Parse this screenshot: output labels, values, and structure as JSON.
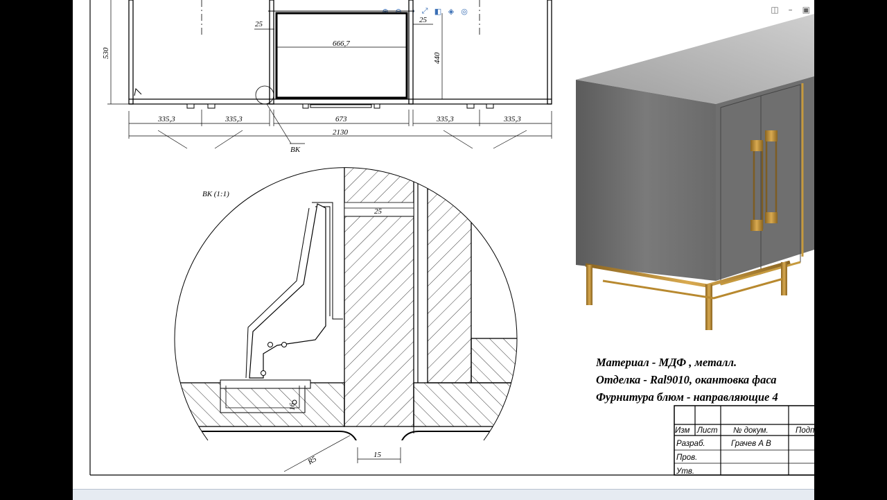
{
  "toolbar": {
    "icons": [
      "zoom-in-icon",
      "zoom-out-icon",
      "rotate-icon",
      "pan-icon",
      "view-icon",
      "display-icon",
      "settings-icon"
    ]
  },
  "window_controls": {
    "icons": [
      "restore-icon",
      "minimize-icon",
      "maximize-icon"
    ]
  },
  "drawing": {
    "top_dims": {
      "d530": "530",
      "d25_left": "25",
      "d666": "666,7",
      "d25_right": "25",
      "d440": "440"
    },
    "bottom_dims": {
      "a": "335,3",
      "b": "335,3",
      "c": "673",
      "d": "335,3",
      "e": "335,3",
      "total": "2130"
    },
    "callout": "ВК",
    "detail_title": "ВК (1:1)",
    "detail_dims": {
      "d25": "25",
      "d16": "16",
      "r5": "R5",
      "d15": "15"
    }
  },
  "notes": {
    "material": "Материал - МДФ , металл.",
    "finish": "Отделка - Ral9010, окантовка фаса",
    "hardware": "Фурнитура блюм - направляющие 4"
  },
  "title_block": {
    "headers": [
      "Изм",
      "Лист",
      "№ докум.",
      "Подп"
    ],
    "rows": [
      {
        "label": "Разраб.",
        "name": "Грачев А В"
      },
      {
        "label": "Пров.",
        "name": ""
      },
      {
        "label": "Утв.",
        "name": ""
      }
    ]
  },
  "colors": {
    "paper": "#ffffff",
    "frame": "#000000",
    "render_body": "#6f6f6f",
    "render_top": "#b0b0b0",
    "gold": "#b8892f",
    "statusbar": "#e6ebf2"
  }
}
